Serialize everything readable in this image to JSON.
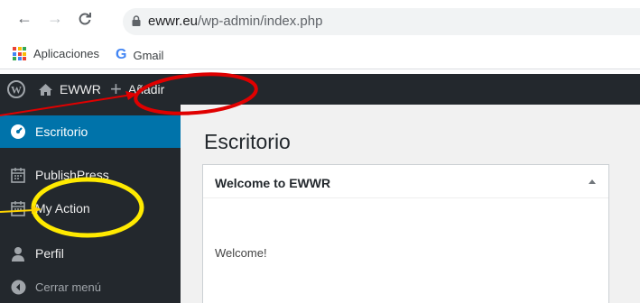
{
  "browser": {
    "url_host": "ewwr.eu",
    "url_path": "/wp-admin/index.php",
    "bookmarks": [
      {
        "label": "Aplicaciones",
        "icon": "apps-grid-icon"
      },
      {
        "label": "Gmail",
        "icon": "google-icon"
      }
    ]
  },
  "adminbar": {
    "site_name": "EWWR",
    "new_label": "Añadir"
  },
  "sidebar": {
    "items": [
      {
        "label": "Escritorio",
        "icon": "dashboard-icon",
        "active": true
      },
      {
        "label": "PublishPress",
        "icon": "calendar-icon"
      },
      {
        "label": "My Action",
        "icon": "calendar-icon"
      },
      {
        "label": "Perfil",
        "icon": "user-icon"
      },
      {
        "label": "Cerrar menú",
        "icon": "collapse-icon"
      }
    ]
  },
  "main": {
    "title": "Escritorio",
    "widget": {
      "title": "Welcome to EWWR",
      "body": "Welcome!"
    }
  },
  "colors": {
    "adminbar_bg": "#23282d",
    "active_menu": "#0073aa",
    "annotation_red": "#e00000",
    "annotation_yellow": "#ffea00"
  }
}
